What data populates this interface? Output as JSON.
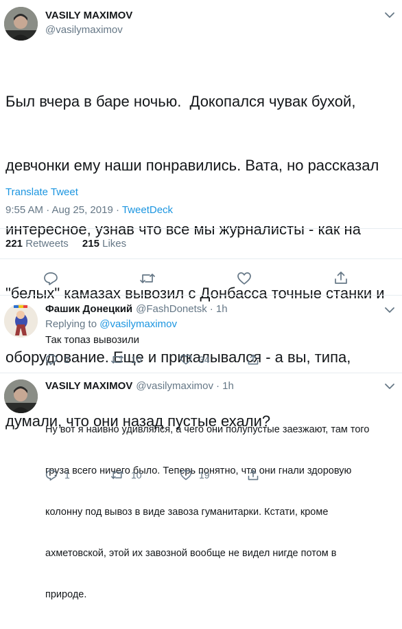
{
  "tweet": {
    "author_name": "VASILY MAXIMOV",
    "author_handle": "@vasilymaximov",
    "lines": [
      "Был вчера в баре ночью.  Докопался чувак бухой,",
      "девчонки ему наши понравились. Вата, но рассказал",
      "интересное, узнав что все мы журналисты - как на",
      "\"белых\" камазах вывозил с Донбасса точные станки и",
      "оборудование. Еще и прикалывался - а вы, типа,",
      "думали, что они назад пустые ехали?"
    ],
    "translate": "Translate Tweet",
    "time": "9:55 AM · Aug 25, 2019 · ",
    "source": "TweetDeck",
    "retweets_count": "221",
    "retweets_label": "Retweets",
    "likes_count": "215",
    "likes_label": "Likes"
  },
  "replies": [
    {
      "author_name": "Фашик Донецкий",
      "author_handle": "@FashDonetsk",
      "age": "· 1h",
      "replying_prefix": "Replying to ",
      "replying_to": "@vasilymaximov",
      "lines": [
        "Так топаз вывозили"
      ],
      "reply_count": "2",
      "retweet_count": "10",
      "like_count": "34"
    },
    {
      "author_name": "VASILY MAXIMOV",
      "author_handle": "@vasilymaximov",
      "age": "· 1h",
      "lines": [
        "Ну вот я наивно удивлялся, а чего они полупустые заезжают, там того",
        "груза всего ничего было. Теперь понятно, что они гнали здоровую",
        "колонну под вывоз в виде завоза гуманитарки. Кстати, кроме",
        "ахметовской, этой их завозной вообще не видел нигде потом в",
        "природе."
      ],
      "reply_count": "1",
      "retweet_count": "10",
      "like_count": "19"
    }
  ],
  "colors": {
    "link": "#1b95e0",
    "muted": "#657786",
    "divider": "#e6ecf0"
  }
}
